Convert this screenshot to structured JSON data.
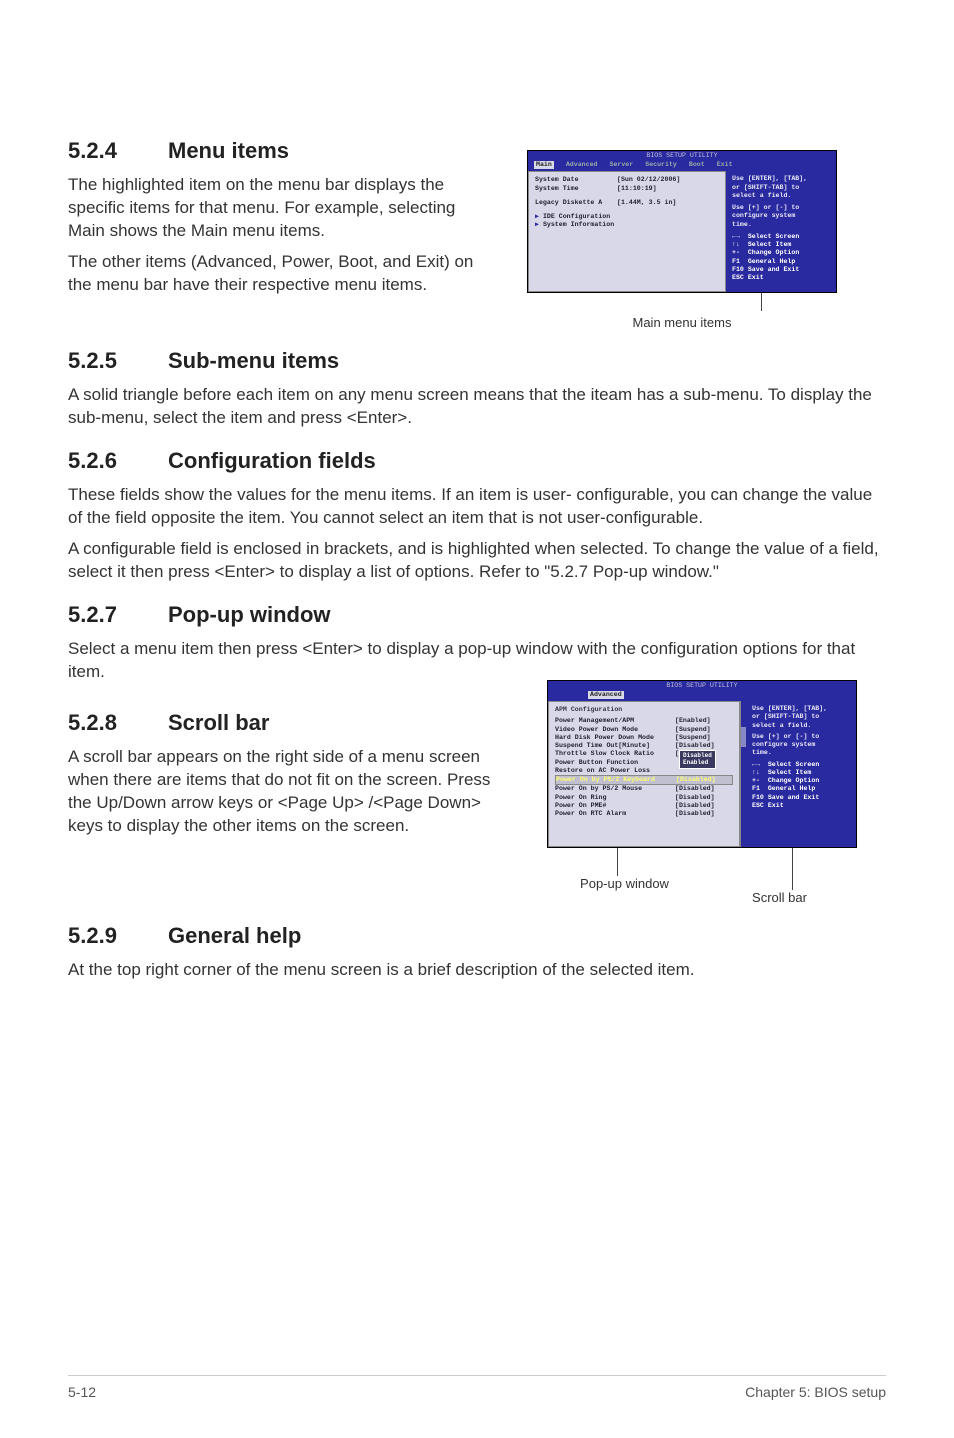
{
  "sections": {
    "s524": {
      "num": "5.2.4",
      "title": "Menu items"
    },
    "s525": {
      "num": "5.2.5",
      "title": "Sub-menu items"
    },
    "s526": {
      "num": "5.2.6",
      "title": "Configuration fields"
    },
    "s527": {
      "num": "5.2.7",
      "title": "Pop-up window"
    },
    "s528": {
      "num": "5.2.8",
      "title": "Scroll bar"
    },
    "s529": {
      "num": "5.2.9",
      "title": "General help"
    }
  },
  "paragraphs": {
    "p524a": "The highlighted item on the menu bar displays the specific items for that menu. For example, selecting Main shows the Main menu items.",
    "p524b": "The other items (Advanced, Power, Boot, and Exit) on the menu bar have their respective menu items.",
    "p525": "A solid triangle before each item on any menu screen means that the iteam has a sub-menu. To display the sub-menu, select the item and press <Enter>.",
    "p526a": "These fields show the values for the menu items. If an item is user- configurable, you can change the value of the field opposite the item. You cannot select an item that is not user-configurable.",
    "p526b": "A configurable field is enclosed in brackets, and is highlighted when selected. To change the value of a field, select it then press <Enter> to display a list of options. Refer to \"5.2.7 Pop-up window.\"",
    "p527": "Select a menu item then press <Enter> to display a pop-up window with the configuration options for that item.",
    "p528": "A scroll bar appears on the right side of a menu screen when there are items that do not fit on the screen. Press the Up/Down arrow keys or <Page Up> /<Page Down> keys to display the other items on the screen.",
    "p529": "At the top right corner of the menu screen is a brief description of the selected item."
  },
  "captions": {
    "mainmenu": "Main menu items",
    "popup": "Pop-up window",
    "scrollbar": "Scroll bar"
  },
  "bios1": {
    "utility_title": "BIOS SETUP UTILITY",
    "menubar": [
      "Main",
      "Advanced",
      "Server",
      "Security",
      "Boot",
      "Exit"
    ],
    "items": {
      "sysdate_k": "System Date",
      "sysdate_v": "[Sun 02/12/2006]",
      "systime_k": "System Time",
      "systime_v": "[11:10:19]",
      "legacy_k": "Legacy Diskette A",
      "legacy_v": "[1.44M, 3.5 in]",
      "ide": "IDE Configuration",
      "sysinfo": "System Information"
    },
    "help": {
      "l1": "Use [ENTER], [TAB],",
      "l2": "or [SHIFT-TAB] to",
      "l3": "select a field.",
      "l4": "Use [+] or [-] to",
      "l5": "configure system",
      "l6": "time.",
      "k1a": "←→",
      "k1b": "Select Screen",
      "k2a": "↑↓",
      "k2b": "Select Item",
      "k3a": "+-",
      "k3b": "Change Option",
      "k4a": "F1",
      "k4b": "General Help",
      "k5a": "F10",
      "k5b": "Save and Exit",
      "k6a": "ESC",
      "k6b": "Exit"
    }
  },
  "bios2": {
    "utility_title": "BIOS SETUP UTILITY",
    "menubar_sel": "Advanced",
    "header": "APM Configuration",
    "items": [
      {
        "k": "Power Management/APM",
        "v": "[Enabled]"
      },
      {
        "k": "Video Power Down Mode",
        "v": "[Suspend]"
      },
      {
        "k": "Hard Disk Power Down Mode",
        "v": "[Suspend]"
      },
      {
        "k": "Suspend Time Out[Minute]",
        "v": "[Disabled]"
      },
      {
        "k": "Throttle Slow Clock Ratio",
        "v": "[50%]"
      },
      {
        "k": "Power Button Function",
        "v": ""
      },
      {
        "k": "Restore on AC Power Loss",
        "v": ""
      },
      {
        "k": "Power On by PS/2 Keyboard",
        "v": "[Disabled]",
        "sel": true
      },
      {
        "k": "Power On by PS/2 Mouse",
        "v": "[Disabled]"
      },
      {
        "k": "Power On Ring",
        "v": "[Disabled]"
      },
      {
        "k": "Power On PME#",
        "v": "[Disabled]"
      },
      {
        "k": "Power On RTC Alarm",
        "v": "[Disabled]"
      }
    ],
    "popup": {
      "o1": "Disabled",
      "o2": "Enabled"
    },
    "help": {
      "l1": "Use [ENTER], [TAB],",
      "l2": "or [SHIFT-TAB] to",
      "l3": "select a field.",
      "l4": "Use [+] or [-] to",
      "l5": "configure system",
      "l6": "time.",
      "k1a": "←→",
      "k1b": "Select Screen",
      "k2a": "↑↓",
      "k2b": "Select Item",
      "k3a": "+-",
      "k3b": "Change Option",
      "k4a": "F1",
      "k4b": "General Help",
      "k5a": "F10",
      "k5b": "Save and Exit",
      "k6a": "ESC",
      "k6b": "Exit"
    }
  },
  "footer": {
    "left": "5-12",
    "right": "Chapter 5: BIOS setup"
  }
}
